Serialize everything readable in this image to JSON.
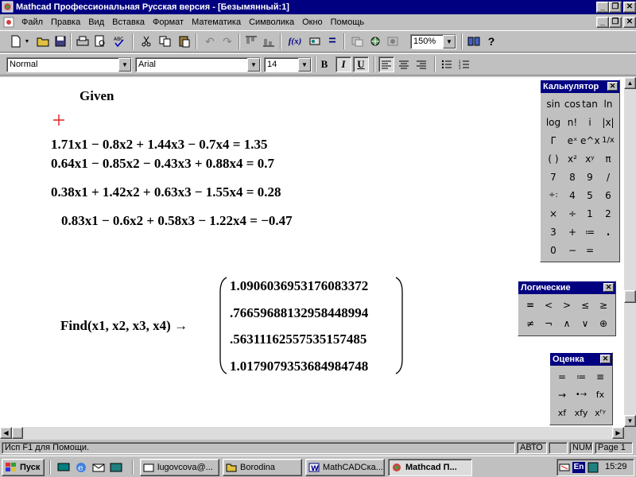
{
  "window": {
    "title": "Mathcad Профессиональная Русская версия - [Безымянный:1]",
    "caption_buttons": [
      "_",
      "❐",
      "✕"
    ],
    "doc_caption_buttons": [
      "_",
      "❐",
      "✕"
    ]
  },
  "menu": [
    "Файл",
    "Правка",
    "Вид",
    "Вставка",
    "Формат",
    "Математика",
    "Символика",
    "Окно",
    "Помощь"
  ],
  "toolbar1": {
    "zoom": "150%",
    "function_label": "f(x)",
    "equals_label": "="
  },
  "toolbar2": {
    "style": "Normal",
    "font": "Arial",
    "size": "14",
    "bold": "B",
    "italic": "I",
    "underline": "U"
  },
  "worksheet": {
    "given": "Given",
    "equations": [
      "1.71x1 − 0.8x2 + 1.44x3 − 0.7x4 = 1.35",
      "0.64x1 − 0.85x2 − 0.43x3 + 0.88x4 = 0.7",
      "0.38x1 + 1.42x2 + 0.63x3 − 1.55x4 = 0.28",
      "0.83x1 − 0.6x2 + 0.58x3 − 1.22x4 = −0.47"
    ],
    "find_expr": "Find(x1, x2, x3, x4) →",
    "results": [
      "1.0906036953176083372",
      ".76659688132958448994",
      ".56311162557535157485",
      "1.0179079353684984748"
    ]
  },
  "palettes": {
    "calculator": {
      "title": "Калькулятор",
      "keys": [
        "sin",
        "cos",
        "tan",
        "ln",
        "log",
        "n!",
        "i",
        "|x|",
        "Γ",
        "eˣ",
        "e^x",
        "1/x",
        "( )",
        "x²",
        "xʸ",
        "π",
        "7",
        "8",
        "9",
        "/",
        "÷:",
        "4",
        "5",
        "6",
        "×",
        "÷",
        "1",
        "2",
        "3",
        "+",
        "≔",
        ".",
        "0",
        "−",
        "="
      ]
    },
    "logic": {
      "title": "Логические",
      "keys": [
        "=",
        "<",
        ">",
        "≤",
        "≥",
        "≠",
        "¬",
        "∧",
        "∨",
        "⊕"
      ]
    },
    "eval": {
      "title": "Оценка",
      "keys": [
        "=",
        "≔",
        "≡",
        "→",
        "•→",
        "fx",
        "xf",
        "xfy",
        "xᶠʸ"
      ]
    }
  },
  "status": {
    "help": "Исп F1 для Помощи.",
    "mode": "АВТО",
    "num": "NUM",
    "page": "Page 1"
  },
  "taskbar": {
    "start": "Пуск",
    "tasks": [
      "lugovcova@...",
      "Borodina",
      "MathCADCка...",
      "Mathcad П..."
    ],
    "lang": "En",
    "clock": "15:29"
  }
}
